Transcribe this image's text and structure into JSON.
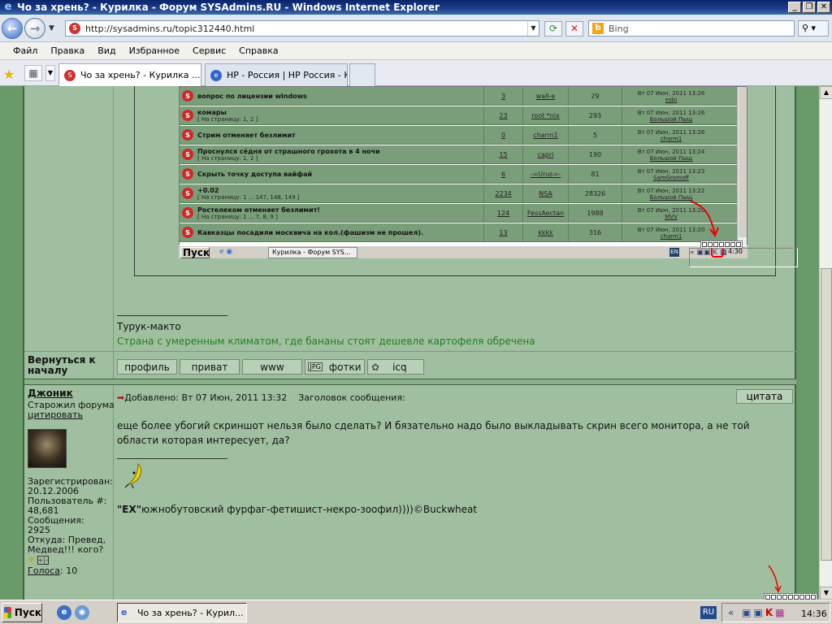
{
  "window": {
    "title": "Чо за хрень? - Курилка - Форум SYSAdmins.RU - Windows Internet Explorer"
  },
  "address": {
    "url": "http://sysadmins.ru/topic312440.html",
    "search_placeholder": "Bing"
  },
  "menu": [
    "Файл",
    "Правка",
    "Вид",
    "Избранное",
    "Сервис",
    "Справка"
  ],
  "tabs": [
    {
      "label": "Чо за хрень? - Курилка ..."
    },
    {
      "label": "HP - Россия | HP Россия - К..."
    }
  ],
  "embedded": {
    "rows": [
      {
        "subject": "вопрос по лицензии windows",
        "pages": "",
        "replies": "3",
        "author": "wall-e",
        "views": "29",
        "date": "Вт 07 Июн, 2011 13:26",
        "last": "esbi"
      },
      {
        "subject": "комары",
        "pages": "[ На страницу: 1, 2 ]",
        "replies": "23",
        "author": "root *nix",
        "views": "293",
        "date": "Вт 07 Июн, 2011 13:26",
        "last": "Большой Пыщ"
      },
      {
        "subject": "Стрим отменяет безлимит",
        "pages": "",
        "replies": "0",
        "author": "charm1",
        "views": "5",
        "date": "Вт 07 Июн, 2011 13:26",
        "last": "charm1"
      },
      {
        "subject": "Проснулся сёдня от страшного грохота в 4 ночи",
        "pages": "[ На страницу: 1, 2 ]",
        "replies": "15",
        "author": "capri",
        "views": "190",
        "date": "Вт 07 Июн, 2011 13:24",
        "last": "Большой Пыщ"
      },
      {
        "subject": "Скрыть точку доступа вайфай",
        "pages": "",
        "replies": "6",
        "author": "-=Urus=-",
        "views": "81",
        "date": "Вт 07 Июн, 2011 13:23",
        "last": "SamGromoff"
      },
      {
        "subject": "+0.02",
        "pages": "[ На страницу: 1 ... 147, 148, 149 ]",
        "replies": "2234",
        "author": "NSA",
        "views": "28326",
        "date": "Вт 07 Июн, 2011 13:22",
        "last": "Большой Пыщ"
      },
      {
        "subject": "Ростелеком отменяет безлимит!",
        "pages": "[ На страницу: 1 ... 7, 8, 9 ]",
        "replies": "124",
        "author": "FessAectan",
        "views": "1988",
        "date": "Вт 07 Июн, 2011 13:20",
        "last": "MVV"
      },
      {
        "subject": "Кавказцы посадили москвича на кол.(фашизм не прошел).",
        "pages": "",
        "replies": "13",
        "author": "kkkk",
        "views": "316",
        "date": "Вт 07 Июн, 2011 13:20",
        "last": "charm1"
      }
    ],
    "taskbar": {
      "start": "Пуск",
      "window": "Курилка - Форум SYS...",
      "lang": "EN",
      "clock": "4:30"
    }
  },
  "post1": {
    "signature_name": "Турук-макто",
    "signature_text": "Страна с умеренным климатом, где бананы стоят дешевле картофеля обречена",
    "back_to_top": "Вернуться к началу",
    "buttons": [
      "профиль",
      "приват",
      "www",
      "фотки",
      "icq"
    ]
  },
  "post2": {
    "author": "Джоник",
    "rank": "Старожил форума",
    "quote_link": "цитировать",
    "posted": "Добавлено: Вт 07 Июн, 2011 13:32",
    "subject_label": "Заголовок сообщения:",
    "quote_button": "цитата",
    "body": "еще более убогий скриншот нельзя было сделать? И бязательно надо было выкладывать скрин всего монитора, а не той области которая интересует, да?",
    "signature_bold": "\"EX\"",
    "signature": "южнобутовский фурфаг-фетишист-некро-зоофил))))©Buckwheat",
    "registered_label": "Зарегистрирован:",
    "registered": "20.12.2006",
    "user_no_label": "Пользователь #:",
    "user_no": "48,681",
    "messages_label": "Сообщения:",
    "messages": "2925",
    "from_label": "Откуда:",
    "from": "Превед, Медвед!!! кого?",
    "votes_label": "Голоса",
    "votes": ": 10"
  },
  "taskbar": {
    "start": "Пуск",
    "window": "Чо за хрень? - Курил...",
    "lang": "RU",
    "clock": "14:36"
  },
  "colors": {
    "forum_bg": "#a0bfa0",
    "border": "#3a6a3a",
    "link_green": "#208020",
    "accent": "#cc2a2a"
  }
}
